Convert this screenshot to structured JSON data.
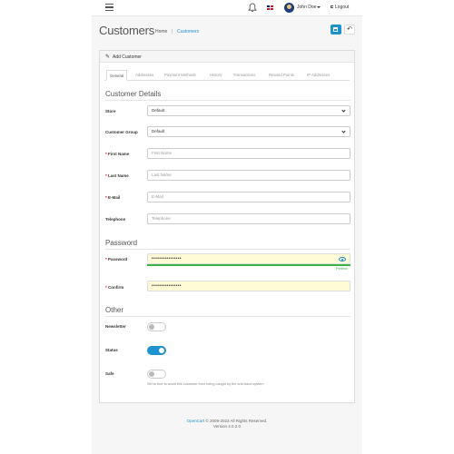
{
  "header": {
    "user_name": "John Doe",
    "logout_label": "Logout"
  },
  "page": {
    "title": "Customers",
    "breadcrumb": [
      {
        "label": "Home"
      },
      {
        "label": "Customers"
      }
    ]
  },
  "card": {
    "title": "Add Customer",
    "tabs": [
      "General",
      "Addresses",
      "Payment Methods",
      "History",
      "Transactions",
      "Reward Points",
      "IP Addresses"
    ],
    "active_tab": "General"
  },
  "details": {
    "section_title": "Customer Details",
    "store_label": "Store",
    "store_value": "Default",
    "group_label": "Customer Group",
    "group_value": "Default",
    "firstname_label": "First Name",
    "firstname_placeholder": "First Name",
    "lastname_label": "Last Name",
    "lastname_placeholder": "Last Name",
    "email_label": "E-Mail",
    "email_placeholder": "E-Mail",
    "telephone_label": "Telephone",
    "telephone_placeholder": "Telephone"
  },
  "password": {
    "section_title": "Password",
    "password_label": "Password",
    "password_value": "••••••••••••••••",
    "strength_text": "Perfect",
    "confirm_label": "Confirm",
    "confirm_value": "••••••••••••••••"
  },
  "other": {
    "section_title": "Other",
    "newsletter_label": "Newsletter",
    "newsletter_on": false,
    "status_label": "Status",
    "status_on": true,
    "safe_label": "Safe",
    "safe_on": false,
    "safe_help": "Set to true to avoid this customer from being caught by the anti-fraud system"
  },
  "footer": {
    "brand": "OpenCart",
    "copyright": "© 2009-2023 All Rights Reserved.",
    "version": "Version 4.0.2.0"
  },
  "colors": {
    "accent": "#1e91cf",
    "required": "#ff0000",
    "strength_bar": "#3cb44b",
    "autofill_bg": "#fffbd6"
  },
  "icons": {
    "menu": "hamburger-icon",
    "notifications": "bell-icon",
    "language": "uk-flag-icon",
    "save": "floppy-icon",
    "back": "reply-icon",
    "card": "pencil-icon",
    "password_visibility": "eye-icon"
  }
}
